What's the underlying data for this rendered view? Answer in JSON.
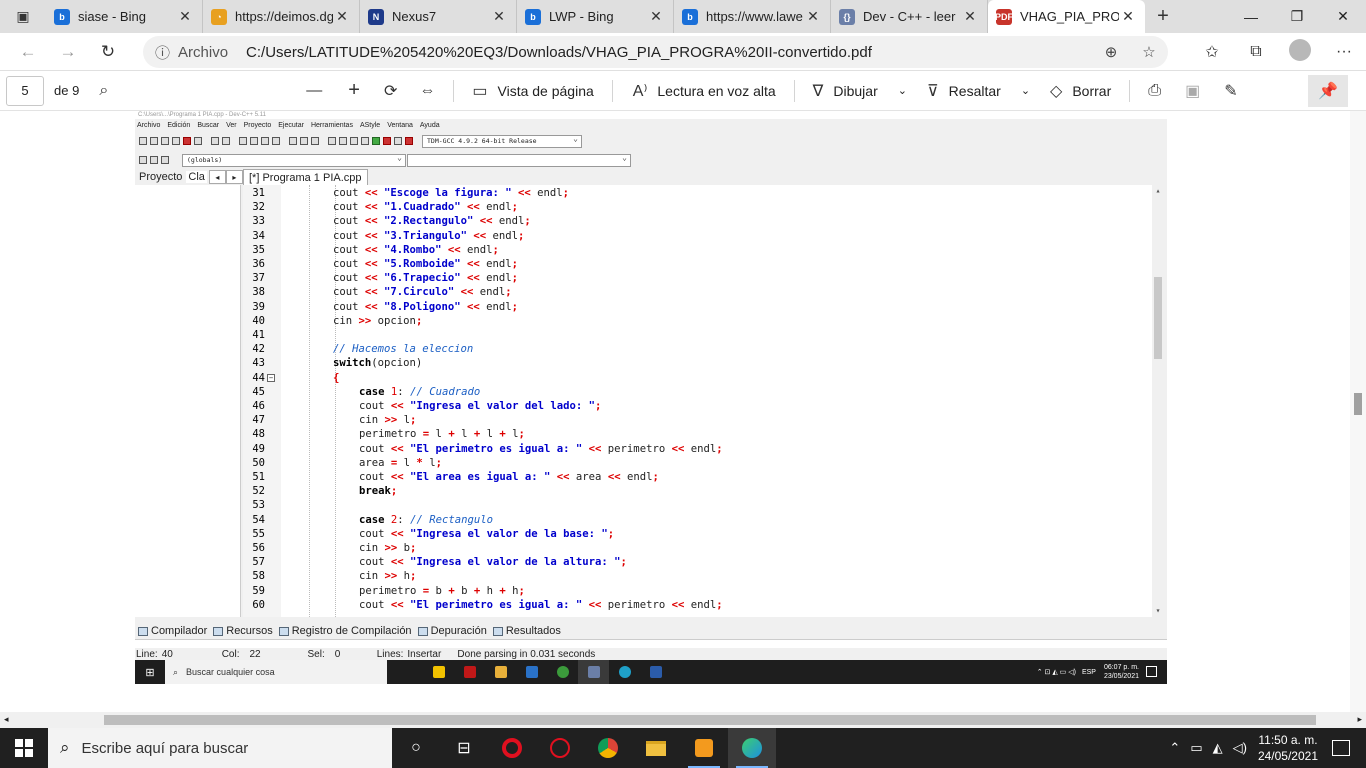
{
  "browser": {
    "tabs": [
      {
        "title": "siase - Bing",
        "fav": "b",
        "color": "#1a6fd8"
      },
      {
        "title": "https://deimos.dg",
        "fav": "◔",
        "color": "#e8a020"
      },
      {
        "title": "Nexus7",
        "fav": "N",
        "color": "#1e3a8a"
      },
      {
        "title": "LWP - Bing",
        "fav": "b",
        "color": "#1a6fd8"
      },
      {
        "title": "https://www.lawe",
        "fav": "b",
        "color": "#1a6fd8"
      },
      {
        "title": "Dev - C++ - leer",
        "fav": "{}",
        "color": "#6b7fa8"
      },
      {
        "title": "VHAG_PIA_PROG",
        "fav": "PDF",
        "color": "#c8342b"
      }
    ],
    "address": {
      "scheme": "Archivo",
      "url": "C:/Users/LATITUDE%205420%20EQ3/Downloads/VHAG_PIA_PROGRA%20II-convertido.pdf"
    }
  },
  "pdf_toolbar": {
    "page": "5",
    "of": "de 9",
    "page_view": "Vista de página",
    "read_aloud": "Lectura en voz alta",
    "draw": "Dibujar",
    "highlight": "Resaltar",
    "erase": "Borrar"
  },
  "devcpp": {
    "title": "C:\\Users\\...\\Programa 1 PIA.cpp - Dev-C++ 5.11",
    "menu": [
      "Archivo",
      "Edición",
      "Buscar",
      "Ver",
      "Proyecto",
      "Ejecutar",
      "Herramientas",
      "AStyle",
      "Ventana",
      "Ayuda"
    ],
    "compiler": "TDM-GCC 4.9.2 64-bit Release",
    "scope": "(globals)",
    "panel_tabs": [
      "Proyecto",
      "Cla"
    ],
    "file_tab": "[*] Programa 1 PIA.cpp",
    "bottom_tabs": [
      "Compilador",
      "Recursos",
      "Registro de Compilación",
      "Depuración",
      "Resultados"
    ],
    "status": {
      "line_label": "Line:",
      "line": "40",
      "col_label": "Col:",
      "col": "22",
      "sel_label": "Sel:",
      "sel": "0",
      "lines_label": "Lines:",
      "mode": "Insertar",
      "msg": "Done parsing in 0.031 seconds"
    },
    "inner_taskbar": {
      "search": "Buscar cualquier cosa",
      "lang": "ESP",
      "time": "06:07 p. m.",
      "date": "23/05/2021"
    }
  },
  "code": [
    {
      "n": "31",
      "indent": 1,
      "tokens": [
        [
          "p",
          "cout "
        ],
        [
          "op",
          "<<"
        ],
        [
          "p",
          " "
        ],
        [
          "str",
          "\"Escoge la figura: \""
        ],
        [
          "p",
          " "
        ],
        [
          "op",
          "<<"
        ],
        [
          "p",
          " endl"
        ],
        [
          "op",
          ";"
        ]
      ]
    },
    {
      "n": "32",
      "indent": 1,
      "tokens": [
        [
          "p",
          "cout "
        ],
        [
          "op",
          "<<"
        ],
        [
          "p",
          " "
        ],
        [
          "str",
          "\"1.Cuadrado\""
        ],
        [
          "p",
          " "
        ],
        [
          "op",
          "<<"
        ],
        [
          "p",
          " endl"
        ],
        [
          "op",
          ";"
        ]
      ]
    },
    {
      "n": "33",
      "indent": 1,
      "tokens": [
        [
          "p",
          "cout "
        ],
        [
          "op",
          "<<"
        ],
        [
          "p",
          " "
        ],
        [
          "str",
          "\"2.Rectangulo\""
        ],
        [
          "p",
          " "
        ],
        [
          "op",
          "<<"
        ],
        [
          "p",
          " endl"
        ],
        [
          "op",
          ";"
        ]
      ]
    },
    {
      "n": "34",
      "indent": 1,
      "tokens": [
        [
          "p",
          "cout "
        ],
        [
          "op",
          "<<"
        ],
        [
          "p",
          " "
        ],
        [
          "str",
          "\"3.Triangulo\""
        ],
        [
          "p",
          " "
        ],
        [
          "op",
          "<<"
        ],
        [
          "p",
          " endl"
        ],
        [
          "op",
          ";"
        ]
      ]
    },
    {
      "n": "35",
      "indent": 1,
      "tokens": [
        [
          "p",
          "cout "
        ],
        [
          "op",
          "<<"
        ],
        [
          "p",
          " "
        ],
        [
          "str",
          "\"4.Rombo\""
        ],
        [
          "p",
          " "
        ],
        [
          "op",
          "<<"
        ],
        [
          "p",
          " endl"
        ],
        [
          "op",
          ";"
        ]
      ]
    },
    {
      "n": "36",
      "indent": 1,
      "tokens": [
        [
          "p",
          "cout "
        ],
        [
          "op",
          "<<"
        ],
        [
          "p",
          " "
        ],
        [
          "str",
          "\"5.Romboide\""
        ],
        [
          "p",
          " "
        ],
        [
          "op",
          "<<"
        ],
        [
          "p",
          " endl"
        ],
        [
          "op",
          ";"
        ]
      ]
    },
    {
      "n": "37",
      "indent": 1,
      "tokens": [
        [
          "p",
          "cout "
        ],
        [
          "op",
          "<<"
        ],
        [
          "p",
          " "
        ],
        [
          "str",
          "\"6.Trapecio\""
        ],
        [
          "p",
          " "
        ],
        [
          "op",
          "<<"
        ],
        [
          "p",
          " endl"
        ],
        [
          "op",
          ";"
        ]
      ]
    },
    {
      "n": "38",
      "indent": 1,
      "tokens": [
        [
          "p",
          "cout "
        ],
        [
          "op",
          "<<"
        ],
        [
          "p",
          " "
        ],
        [
          "str",
          "\"7.Circulo\""
        ],
        [
          "p",
          " "
        ],
        [
          "op",
          "<<"
        ],
        [
          "p",
          " endl"
        ],
        [
          "op",
          ";"
        ]
      ]
    },
    {
      "n": "39",
      "indent": 1,
      "tokens": [
        [
          "p",
          "cout "
        ],
        [
          "op",
          "<<"
        ],
        [
          "p",
          " "
        ],
        [
          "str",
          "\"8.Poligono\""
        ],
        [
          "p",
          " "
        ],
        [
          "op",
          "<<"
        ],
        [
          "p",
          " endl"
        ],
        [
          "op",
          ";"
        ]
      ]
    },
    {
      "n": "40",
      "indent": 1,
      "tokens": [
        [
          "p",
          "cin "
        ],
        [
          "op",
          ">>"
        ],
        [
          "p",
          " opcion"
        ],
        [
          "op",
          ";"
        ]
      ]
    },
    {
      "n": "41",
      "indent": 1,
      "tokens": []
    },
    {
      "n": "42",
      "indent": 1,
      "tokens": [
        [
          "cm",
          "// Hacemos la eleccion"
        ]
      ]
    },
    {
      "n": "43",
      "indent": 1,
      "tokens": [
        [
          "kw",
          "switch"
        ],
        [
          "p",
          "(opcion)"
        ]
      ]
    },
    {
      "n": "44",
      "indent": 1,
      "fold": true,
      "tokens": [
        [
          "op",
          "{"
        ]
      ]
    },
    {
      "n": "45",
      "indent": 2,
      "tokens": [
        [
          "kw",
          "case"
        ],
        [
          "p",
          " "
        ],
        [
          "numc",
          "1"
        ],
        [
          "p",
          ": "
        ],
        [
          "cm",
          "// Cuadrado"
        ]
      ]
    },
    {
      "n": "46",
      "indent": 2,
      "tokens": [
        [
          "p",
          "cout "
        ],
        [
          "op",
          "<<"
        ],
        [
          "p",
          " "
        ],
        [
          "str",
          "\"Ingresa el valor del lado: \""
        ],
        [
          "op",
          ";"
        ]
      ]
    },
    {
      "n": "47",
      "indent": 2,
      "tokens": [
        [
          "p",
          "cin "
        ],
        [
          "op",
          ">>"
        ],
        [
          "p",
          " l"
        ],
        [
          "op",
          ";"
        ]
      ]
    },
    {
      "n": "48",
      "indent": 2,
      "tokens": [
        [
          "p",
          "perimetro "
        ],
        [
          "op",
          "="
        ],
        [
          "p",
          " l "
        ],
        [
          "op",
          "+"
        ],
        [
          "p",
          " l "
        ],
        [
          "op",
          "+"
        ],
        [
          "p",
          " l "
        ],
        [
          "op",
          "+"
        ],
        [
          "p",
          " l"
        ],
        [
          "op",
          ";"
        ]
      ]
    },
    {
      "n": "49",
      "indent": 2,
      "tokens": [
        [
          "p",
          "cout "
        ],
        [
          "op",
          "<<"
        ],
        [
          "p",
          " "
        ],
        [
          "str",
          "\"El perimetro es igual a: \""
        ],
        [
          "p",
          " "
        ],
        [
          "op",
          "<<"
        ],
        [
          "p",
          " perimetro "
        ],
        [
          "op",
          "<<"
        ],
        [
          "p",
          " endl"
        ],
        [
          "op",
          ";"
        ]
      ]
    },
    {
      "n": "50",
      "indent": 2,
      "tokens": [
        [
          "p",
          "area "
        ],
        [
          "op",
          "="
        ],
        [
          "p",
          " l "
        ],
        [
          "op",
          "*"
        ],
        [
          "p",
          " l"
        ],
        [
          "op",
          ";"
        ]
      ]
    },
    {
      "n": "51",
      "indent": 2,
      "tokens": [
        [
          "p",
          "cout "
        ],
        [
          "op",
          "<<"
        ],
        [
          "p",
          " "
        ],
        [
          "str",
          "\"El area es igual a: \""
        ],
        [
          "p",
          " "
        ],
        [
          "op",
          "<<"
        ],
        [
          "p",
          " area "
        ],
        [
          "op",
          "<<"
        ],
        [
          "p",
          " endl"
        ],
        [
          "op",
          ";"
        ]
      ]
    },
    {
      "n": "52",
      "indent": 2,
      "tokens": [
        [
          "kw",
          "break"
        ],
        [
          "op",
          ";"
        ]
      ]
    },
    {
      "n": "53",
      "indent": 2,
      "tokens": []
    },
    {
      "n": "54",
      "indent": 2,
      "tokens": [
        [
          "kw",
          "case"
        ],
        [
          "p",
          " "
        ],
        [
          "numc",
          "2"
        ],
        [
          "p",
          ": "
        ],
        [
          "cm",
          "// Rectangulo"
        ]
      ]
    },
    {
      "n": "55",
      "indent": 2,
      "tokens": [
        [
          "p",
          "cout "
        ],
        [
          "op",
          "<<"
        ],
        [
          "p",
          " "
        ],
        [
          "str",
          "\"Ingresa el valor de la base: \""
        ],
        [
          "op",
          ";"
        ]
      ]
    },
    {
      "n": "56",
      "indent": 2,
      "tokens": [
        [
          "p",
          "cin "
        ],
        [
          "op",
          ">>"
        ],
        [
          "p",
          " b"
        ],
        [
          "op",
          ";"
        ]
      ]
    },
    {
      "n": "57",
      "indent": 2,
      "tokens": [
        [
          "p",
          "cout "
        ],
        [
          "op",
          "<<"
        ],
        [
          "p",
          " "
        ],
        [
          "str",
          "\"Ingresa el valor de la altura: \""
        ],
        [
          "op",
          ";"
        ]
      ]
    },
    {
      "n": "58",
      "indent": 2,
      "tokens": [
        [
          "p",
          "cin "
        ],
        [
          "op",
          ">>"
        ],
        [
          "p",
          " h"
        ],
        [
          "op",
          ";"
        ]
      ]
    },
    {
      "n": "59",
      "indent": 2,
      "tokens": [
        [
          "p",
          "perimetro "
        ],
        [
          "op",
          "="
        ],
        [
          "p",
          " b "
        ],
        [
          "op",
          "+"
        ],
        [
          "p",
          " b "
        ],
        [
          "op",
          "+"
        ],
        [
          "p",
          " h "
        ],
        [
          "op",
          "+"
        ],
        [
          "p",
          " h"
        ],
        [
          "op",
          ";"
        ]
      ]
    },
    {
      "n": "60",
      "indent": 2,
      "tokens": [
        [
          "p",
          "cout "
        ],
        [
          "op",
          "<<"
        ],
        [
          "p",
          " "
        ],
        [
          "str",
          "\"El perimetro es igual a: \""
        ],
        [
          "p",
          " "
        ],
        [
          "op",
          "<<"
        ],
        [
          "p",
          " perimetro "
        ],
        [
          "op",
          "<<"
        ],
        [
          "p",
          " endl"
        ],
        [
          "op",
          ";"
        ]
      ]
    }
  ],
  "taskbar": {
    "search": "Escribe aquí para buscar",
    "time": "11:50 a. m.",
    "date": "24/05/2021"
  },
  "colors": {
    "accent": "#1a6fd8",
    "pdf": "#c8342b"
  }
}
